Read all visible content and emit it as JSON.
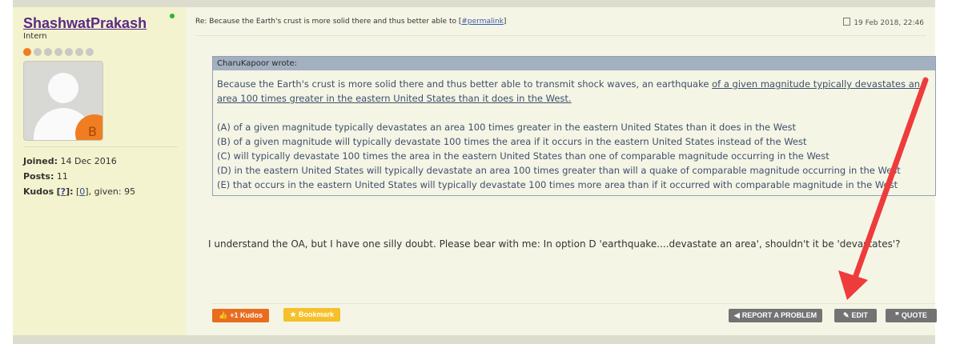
{
  "author": {
    "username": "ShashwatPrakash",
    "rank": "Intern",
    "rank_level": 1,
    "rank_max": 7,
    "avatar_letter": "B",
    "joined_label": "Joined:",
    "joined_value": "14 Dec 2016",
    "posts_label": "Posts:",
    "posts_value": "11",
    "kudos_label": "Kudos",
    "kudos_help": "?",
    "kudos_value": "0",
    "kudos_given": ", given: 95"
  },
  "post": {
    "title": "Re: Because the Earth's crust is more solid there and thus better able to",
    "permalink": "#permalink",
    "date": "19 Feb 2018, 22:46",
    "message": "I understand the OA, but I have one silly doubt. Please bear with me: In option D 'earthquake....devastate an area', shouldn't it be 'devastates'?"
  },
  "quote": {
    "author_line": "CharuKapoor wrote:",
    "stem_plain": "Because the Earth's crust is more solid there and thus better able to transmit shock waves, an earthquake ",
    "stem_underlined_1": "of a given magnitude typically devastates an",
    "stem_underlined_2": "area 100 times greater in the eastern United States than it does in the West.",
    "options": [
      "(A) of a given magnitude typically devastates an area 100 times greater in the eastern United States than it does in the West",
      "(B) of a given magnitude will typically devastate 100 times the area if it occurs in the eastern United States instead of the West",
      "(C) will typically devastate 100 times the area in the eastern United States than one of comparable magnitude occurring in the West",
      "(D) in the eastern United States will typically devastate an area 100 times greater than will a quake of comparable magnitude occurring in the West",
      "(E) that occurs in the eastern United States will typically devastate 100 times more area than if it occurred with comparable magnitude in the West"
    ]
  },
  "actions": {
    "kudos": "+1 Kudos",
    "bookmark": "Bookmark",
    "report": "REPORT A PROBLEM",
    "edit": "EDIT",
    "quote": "QUOTE"
  },
  "colors": {
    "username": "#5a2a86",
    "kudos_button": "#e86d1f",
    "bookmark_button": "#f5c02a",
    "action_button": "#737373",
    "annotation_arrow": "#ee3b3b"
  }
}
